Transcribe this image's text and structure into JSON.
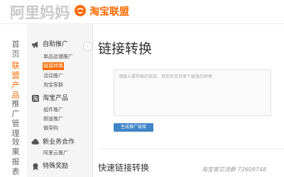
{
  "header": {
    "brand": "阿里妈妈",
    "partner": "淘宝联盟",
    "partner_color": "#ff6a00"
  },
  "primary_nav": [
    {
      "label": "首页",
      "active": false
    },
    {
      "label": "联盟产品",
      "active": true
    },
    {
      "label": "推广管理",
      "active": false
    },
    {
      "label": "效果报表",
      "active": false
    }
  ],
  "sub_nav": {
    "groups": [
      {
        "label": "自助推广",
        "icon": "megaphone-icon",
        "items": [
          {
            "label": "单品店铺推广",
            "active": false
          },
          {
            "label": "链接转换",
            "active": true
          },
          {
            "label": "活动推广",
            "active": false
          },
          {
            "label": "淘宝客群",
            "active": false
          }
        ]
      },
      {
        "label": "淘宝产品",
        "icon": "taobao-icon",
        "items": [
          {
            "label": "组件推广",
            "active": false
          },
          {
            "label": "频道推广",
            "active": false
          },
          {
            "label": "微导购",
            "active": false
          }
        ]
      },
      {
        "label": "新业务合作",
        "icon": "cloud-icon",
        "items": [
          {
            "label": "阿里云推广",
            "active": false
          }
        ]
      },
      {
        "label": "特殊奖励",
        "icon": "award-icon",
        "items": []
      }
    ],
    "collapse_glyph": "‹"
  },
  "main": {
    "title": "链接转换",
    "input_placeholder": "请输入要转换的链接，目前仅支持单个链接的转换",
    "generate_button": "生成推广链接",
    "section_title": "快速链接转换"
  },
  "watermark": "淘宝客交流群 72608748",
  "colors": {
    "accent": "#ff6a00",
    "button": "#3f86c7",
    "sidebar_bg": "#f5f5f5"
  }
}
